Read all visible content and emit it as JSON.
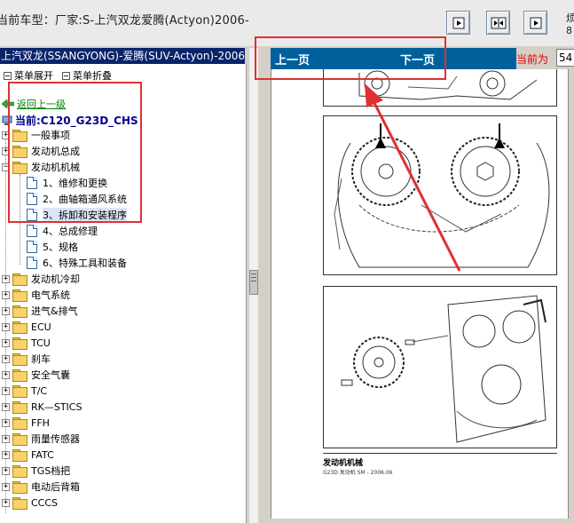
{
  "header": {
    "car_label": "当前车型：厂家:S-上汽双龙爱腾(Actyon)2006-",
    "clipped_right_glyphs": "烦 8"
  },
  "toolbar": {
    "buttons": [
      {
        "icon": "next-page-icon"
      },
      {
        "icon": "split-view-icon"
      },
      {
        "icon": "single-page-icon"
      }
    ]
  },
  "left_panel": {
    "title": "上汽双龙(SSANGYONG)-爱腾(SUV-Actyon)-2006-",
    "menu": {
      "expand_label": "菜单展开",
      "collapse_label": "菜单折叠"
    },
    "back_label": "返回上一级",
    "current_label": "当前:C120_G23D_CHS",
    "tree": [
      {
        "label": "一般事项",
        "expanded": false
      },
      {
        "label": "发动机总成",
        "expanded": false
      },
      {
        "label": "发动机机械",
        "expanded": true,
        "children": [
          {
            "label": "1、维修和更换"
          },
          {
            "label": "2、曲轴箱通风系统"
          },
          {
            "label": "3、拆卸和安装程序",
            "selected": true
          },
          {
            "label": "4、总成修理"
          },
          {
            "label": "5、规格"
          },
          {
            "label": "6、特殊工具和装备"
          }
        ]
      },
      {
        "label": "发动机冷却",
        "expanded": false
      },
      {
        "label": "电气系统",
        "expanded": false
      },
      {
        "label": "进气&排气",
        "expanded": false
      },
      {
        "label": "ECU",
        "expanded": false
      },
      {
        "label": "TCU",
        "expanded": false
      },
      {
        "label": "刹车",
        "expanded": false
      },
      {
        "label": "安全气囊",
        "expanded": false
      },
      {
        "label": "T/C",
        "expanded": false
      },
      {
        "label": "RK—STICS",
        "expanded": false
      },
      {
        "label": "FFH",
        "expanded": false
      },
      {
        "label": "雨量传感器",
        "expanded": false
      },
      {
        "label": "FATC",
        "expanded": false
      },
      {
        "label": "TGS档把",
        "expanded": false
      },
      {
        "label": "电动后背箱",
        "expanded": false
      },
      {
        "label": "CCCS",
        "expanded": false
      }
    ]
  },
  "right_panel": {
    "prev_label": "上一页",
    "next_label": "下一页",
    "page_label": "当前为",
    "page_value": "54",
    "doc_footer_title": "发动机机械",
    "doc_footer_sub": "G23D 发动机 SM - 2006.06"
  },
  "annotation_color": "#e03030"
}
